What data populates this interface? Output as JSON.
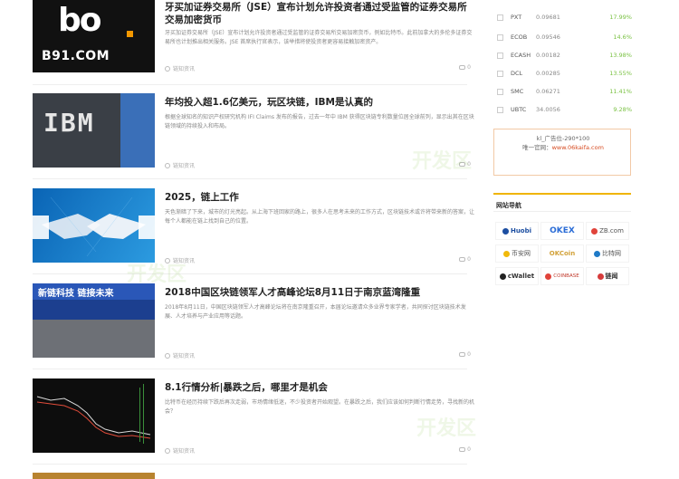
{
  "articles": [
    {
      "title": "牙买加证券交易所（JSE）宣布计划允许投资者通过受监管的证券交易所交易加密货币",
      "desc": "牙买加证券交易所（JSE）宣布计划允许投资者通过受监管的证券交易所交易加密货币，例如比特币。此前加拿大的多伦多证券交易所也计划推出相关服务。JSE 首席执行官表示，该举措将使投资者更容易接触加密资产。",
      "source": "链知资讯",
      "comments": "0",
      "thumb_big": "bo",
      "thumb_domain": "B91.COM"
    },
    {
      "title": "年均投入超1.6亿美元，玩区块链，IBM是认真的",
      "desc": "根据全球知名的知识产权研究机构 IFI Claims 发布的报告，过去一年中 IBM 获得区块链专利数量位居全球前列，显示出其在区块链领域的持续投入和布局。",
      "source": "链知资讯",
      "comments": "0",
      "thumb_text": "IBM"
    },
    {
      "title": "2025，链上工作",
      "desc": "天色渐暗了下来，城市的灯光亮起。从上海下班回家的路上，很多人在思考未来的工作方式，区块链技术或许将带来新的答案，让每个人都能在链上找到自己的位置。",
      "source": "链知资讯",
      "comments": "0"
    },
    {
      "title": "2018中国区块链领军人才高峰论坛8月11日于南京蓝湾隆重",
      "desc": "2018年8月11日，中国区块链领军人才高峰论坛将在南京隆重召开，本届论坛邀请众多业界专家学者，共同探讨区块链技术发展、人才培养与产业应用等话题。",
      "source": "链知资讯",
      "comments": "0",
      "thumb_text": "新链科技 链接未来"
    },
    {
      "title": "8.1行情分析|暴跌之后，哪里才是机会",
      "desc": "比特币在经历持续下跌后再次走弱，市场情绪低迷，不少投资者开始观望。在暴跌之后，我们应该如何判断行情走势，寻找新的机会？",
      "source": "链知资讯",
      "comments": "0"
    }
  ],
  "sidebar": {
    "coins": [
      {
        "name": "PXT",
        "price": "0.09681",
        "change": "17.99%"
      },
      {
        "name": "ECOB",
        "price": "0.09546",
        "change": "14.6%"
      },
      {
        "name": "ECASH",
        "price": "0.00182",
        "change": "13.98%"
      },
      {
        "name": "DCL",
        "price": "0.00285",
        "change": "13.55%"
      },
      {
        "name": "SMC",
        "price": "0.06271",
        "change": "11.41%"
      },
      {
        "name": "UBTC",
        "price": "34.0056",
        "change": "9.28%"
      }
    ],
    "ad": {
      "line1": "kl_广告位-290*100",
      "contact_label": "唯一官网：",
      "contact_link": "www.06kaifa.com"
    },
    "partners_title": "网站导航",
    "partners": [
      "Huobi",
      "OKEX",
      "ZB.com",
      "币安网",
      "OKCoin",
      "比特网",
      "cWallet",
      "COINBASE",
      "链闻"
    ]
  },
  "watermark": "开发区"
}
